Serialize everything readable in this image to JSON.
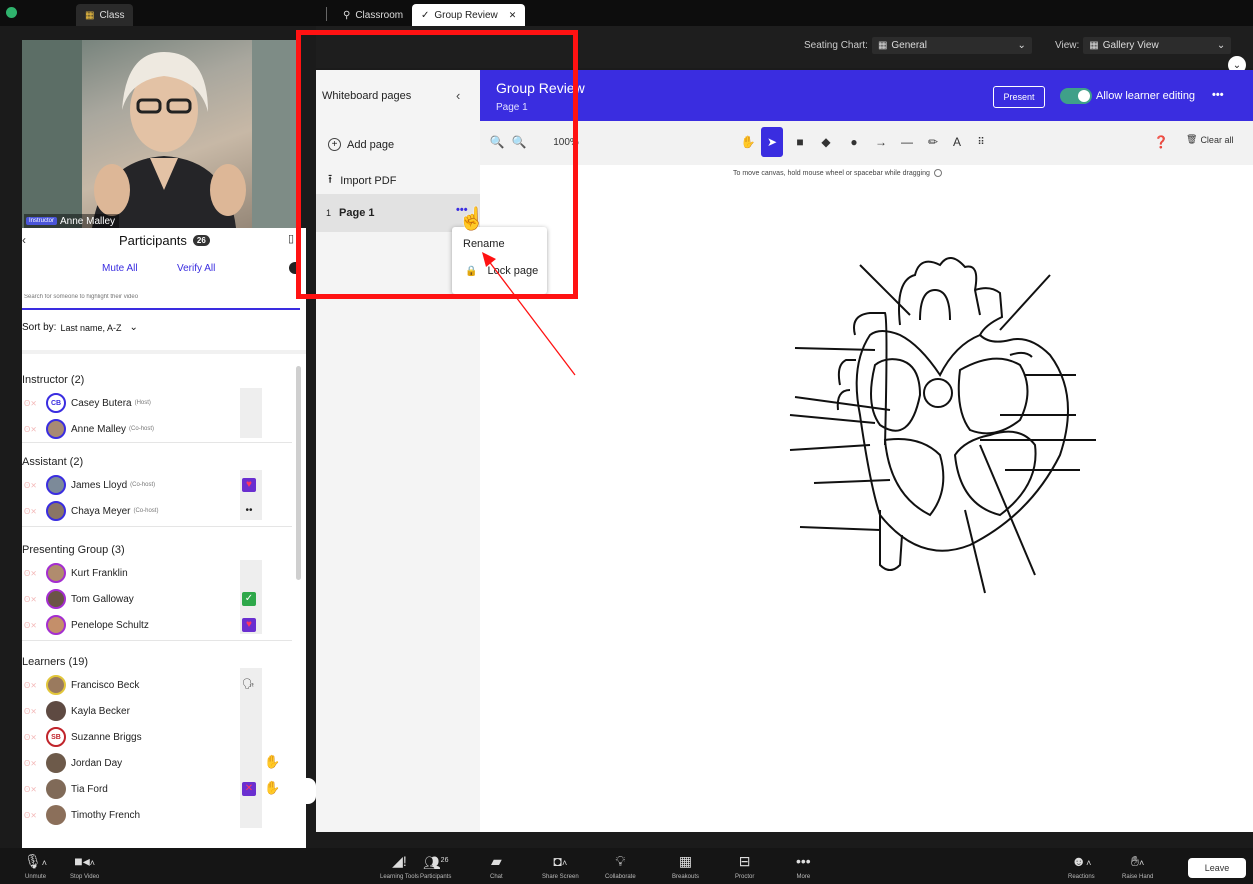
{
  "tabs": {
    "class": "Class",
    "classroom": "Classroom",
    "group_review": "Group Review",
    "close": "✕"
  },
  "stage": {
    "seating_label": "Seating Chart:",
    "seating_value": "General",
    "view_label": "View:",
    "view_value": "Gallery View"
  },
  "video": {
    "role": "Instructor",
    "name": "Anne Malley"
  },
  "participants": {
    "title": "Participants",
    "count": "26",
    "mute_all": "Mute All",
    "verify_all": "Verify All",
    "search_placeholder": "Search for someone to highlight their video",
    "sort_label": "Sort by:",
    "sort_value": "Last name, A-Z",
    "groups": [
      {
        "label": "Instructor (2)"
      },
      {
        "label": "Assistant (2)"
      },
      {
        "label": "Presenting Group (3)"
      },
      {
        "label": "Learners (19)"
      }
    ],
    "people": [
      {
        "initials": "CB",
        "name": "Casey Butera",
        "role": "(Host)"
      },
      {
        "initials": "",
        "name": "Anne Malley",
        "role": "(Co-host)"
      },
      {
        "initials": "",
        "name": "James Lloyd",
        "role": "(Co-host)"
      },
      {
        "initials": "",
        "name": "Chaya Meyer",
        "role": "(Co-host)"
      },
      {
        "initials": "",
        "name": "Kurt Franklin",
        "role": ""
      },
      {
        "initials": "",
        "name": "Tom Galloway",
        "role": ""
      },
      {
        "initials": "",
        "name": "Penelope Schultz",
        "role": ""
      },
      {
        "initials": "",
        "name": "Francisco Beck",
        "role": ""
      },
      {
        "initials": "",
        "name": "Kayla Becker",
        "role": ""
      },
      {
        "initials": "SB",
        "name": "Suzanne Briggs",
        "role": ""
      },
      {
        "initials": "",
        "name": "Jordan Day",
        "role": ""
      },
      {
        "initials": "",
        "name": "Tia Ford",
        "role": ""
      },
      {
        "initials": "",
        "name": "Timothy French",
        "role": ""
      }
    ]
  },
  "whiteboard": {
    "sidebar_title": "Whiteboard pages",
    "add_page": "Add page",
    "import_pdf": "Import PDF",
    "page_number": "1",
    "page_name": "Page 1",
    "menu_rename": "Rename",
    "menu_lock": "Lock page",
    "title": "Group Review",
    "subtitle": "Page 1",
    "present": "Present",
    "allow_editing": "Allow learner editing",
    "more": "•••",
    "zoom": "100%",
    "hint": "To move canvas, hold mouse wheel or spacebar while dragging",
    "clear_all": "Clear all"
  },
  "toolbar": {
    "unmute": "Unmute",
    "stop_video": "Stop Video",
    "learning_tools": "Learning Tools",
    "participants": "Participants",
    "participants_count": "26",
    "chat": "Chat",
    "share_screen": "Share Screen",
    "collaborate": "Collaborate",
    "breakouts": "Breakouts",
    "proctor": "Proctor",
    "more": "More",
    "reactions": "Reactions",
    "raise_hand": "Raise Hand",
    "leave": "Leave"
  },
  "colors": {
    "accent": "#3a2de0",
    "highlight": "#ff1212",
    "toggle": "#3fa089"
  }
}
